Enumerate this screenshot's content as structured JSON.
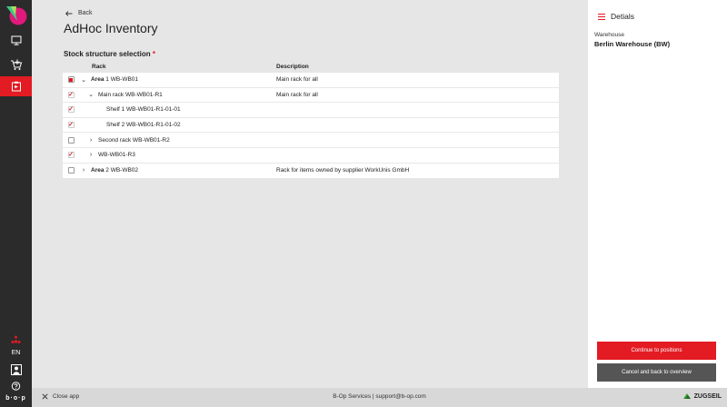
{
  "rail": {
    "items": [
      {
        "icon": "monitor-icon"
      },
      {
        "icon": "cart-icon"
      },
      {
        "icon": "inventory-icon",
        "active": true
      }
    ],
    "lang": "EN",
    "bottom_logo": "b·o·p"
  },
  "header": {
    "back_label": "Back",
    "title": "AdHoc Inventory"
  },
  "section": {
    "label": "Stock structure selection",
    "required_mark": "*"
  },
  "table": {
    "columns": [
      "Rack",
      "Description"
    ],
    "rows": [
      {
        "check": "partial",
        "chevron": "down",
        "bold": "Area",
        "name": " 1 WB-WB01",
        "desc": "Main rack for all"
      },
      {
        "check": "checked",
        "chevron": "down",
        "bold": "",
        "name": "Main rack WB-WB01-R1",
        "desc": "Main rack for all"
      },
      {
        "check": "checked",
        "chevron": "",
        "bold": "",
        "name": "Shelf 1 WB-WB01-R1-01-01",
        "desc": ""
      },
      {
        "check": "checked",
        "chevron": "",
        "bold": "",
        "name": "Shelf 2 WB-WB01-R1-01-02",
        "desc": ""
      },
      {
        "check": "unchecked",
        "chevron": "right",
        "bold": "",
        "name": "Second rack WB-WB01-R2",
        "desc": ""
      },
      {
        "check": "checked",
        "chevron": "right",
        "bold": "",
        "name": "WB-WB01-R3",
        "desc": ""
      },
      {
        "check": "unchecked",
        "chevron": "right",
        "bold": "Area",
        "name": " 2 WB-WB02",
        "desc": "Rack for items owned by supplier WorkUnis GmbH"
      }
    ]
  },
  "panel": {
    "title": "Detials",
    "warehouse_label": "Warehouse",
    "warehouse_value": "Berlin Warehouse (BW)",
    "continue_label": "Continue to positions",
    "cancel_label": "Cancel and back to overview"
  },
  "footer": {
    "close_label": "Close app",
    "center_text": "B-Op Services | support@b-op.com",
    "brand": "ZUGSEIL"
  },
  "colors": {
    "accent": "#e31b23",
    "rail": "#2b2b2b",
    "background": "#e6e6e6"
  }
}
